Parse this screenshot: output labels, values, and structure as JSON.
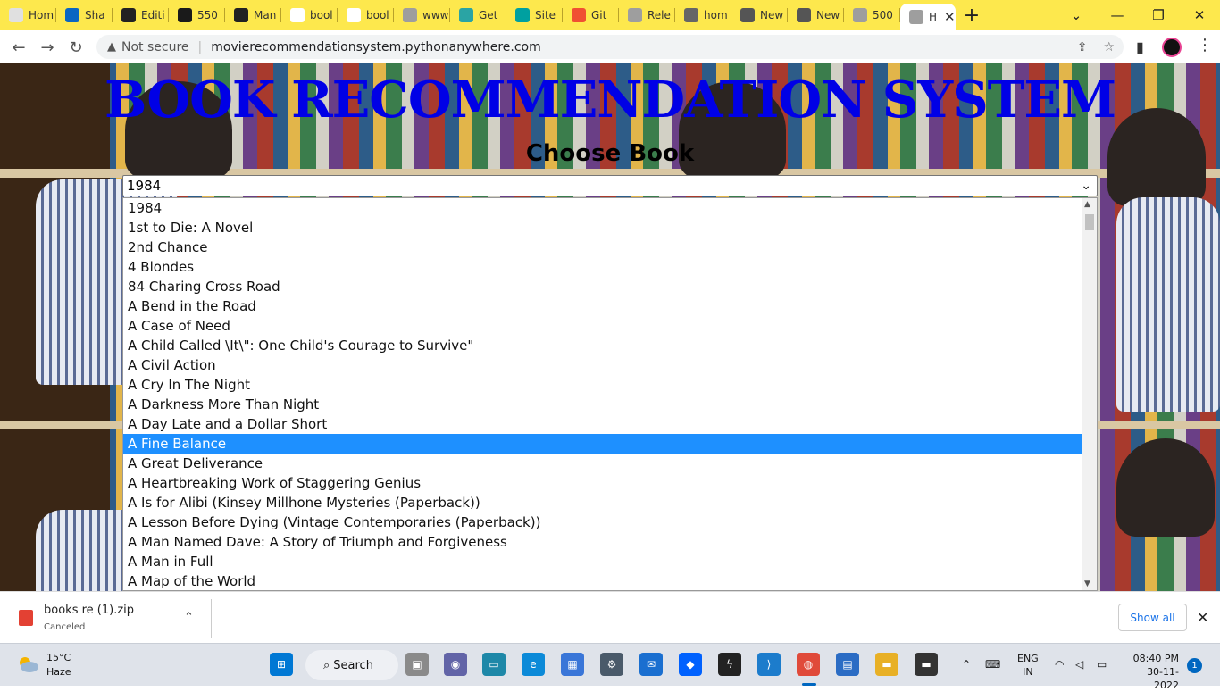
{
  "browser": {
    "tabs": [
      {
        "label": "Hom",
        "icon": "globe-icon",
        "color": "#e0e0e0"
      },
      {
        "label": "Sha",
        "icon": "linkedin-icon",
        "color": "#0a66c2"
      },
      {
        "label": "Editi",
        "icon": "github-icon",
        "color": "#222222"
      },
      {
        "label": "550",
        "icon": "site-icon",
        "color": "#1a1a1a"
      },
      {
        "label": "Man",
        "icon": "site-icon",
        "color": "#222222"
      },
      {
        "label": "bool",
        "icon": "google-icon",
        "color": "#ffffff"
      },
      {
        "label": "bool",
        "icon": "google-icon",
        "color": "#ffffff"
      },
      {
        "label": "www",
        "icon": "globe-icon",
        "color": "#9e9e9e"
      },
      {
        "label": "Get",
        "icon": "site-icon",
        "color": "#2aa4a4"
      },
      {
        "label": "Site",
        "icon": "diamond-icon",
        "color": "#00a0a0"
      },
      {
        "label": "Git",
        "icon": "git-icon",
        "color": "#f05032"
      },
      {
        "label": "Rele",
        "icon": "globe-icon",
        "color": "#9e9e9e"
      },
      {
        "label": "hom",
        "icon": "site-icon",
        "color": "#666666"
      },
      {
        "label": "New",
        "icon": "chrome-icon",
        "color": "#555555"
      },
      {
        "label": "New",
        "icon": "chrome-icon",
        "color": "#555555"
      },
      {
        "label": "500",
        "icon": "globe-icon",
        "color": "#9e9e9e"
      }
    ],
    "active_tab": {
      "label": "H"
    },
    "address": {
      "security": "Not secure",
      "url": "movierecommendationsystem.pythonanywhere.com"
    }
  },
  "page": {
    "title": "BOOK RECOMMENDATION SYSTEM",
    "subtitle": "Choose Book",
    "select": {
      "selected_value": "1984",
      "options": [
        "1984",
        "1st to Die: A Novel",
        "2nd Chance",
        "4 Blondes",
        "84 Charing Cross Road",
        "A Bend in the Road",
        "A Case of Need",
        "A Child Called \\It\\\": One Child's Courage to Survive\"",
        "A Civil Action",
        "A Cry In The Night",
        "A Darkness More Than Night",
        "A Day Late and a Dollar Short",
        "A Fine Balance",
        "A Great Deliverance",
        "A Heartbreaking Work of Staggering Genius",
        "A Is for Alibi (Kinsey Millhone Mysteries (Paperback))",
        "A Lesson Before Dying (Vintage Contemporaries (Paperback))",
        "A Man Named Dave: A Story of Triumph and Forgiveness",
        "A Man in Full",
        "A Map of the World"
      ],
      "highlighted": "A Fine Balance"
    }
  },
  "download_bar": {
    "file_name": "books re (1).zip",
    "status": "Canceled",
    "show_all": "Show all"
  },
  "taskbar": {
    "weather_temp": "15°C",
    "weather_desc": "Haze",
    "search_label": "Search",
    "lang_line1": "ENG",
    "lang_line2": "IN",
    "time": "08:40 PM",
    "date": "30-11-2022",
    "notifications": "1"
  }
}
